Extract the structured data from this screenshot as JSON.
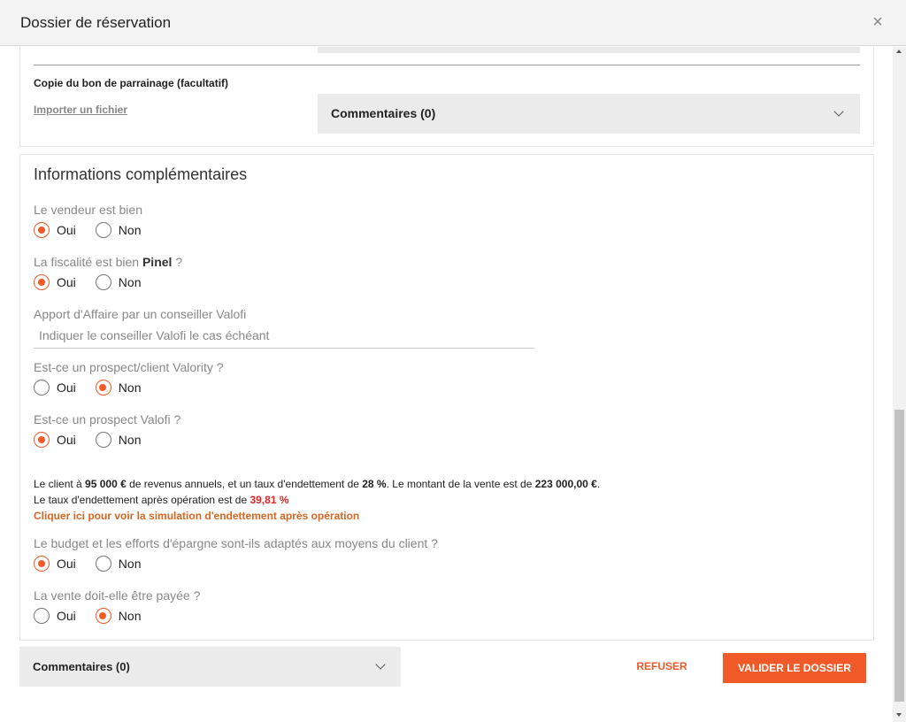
{
  "header": {
    "title": "Dossier de réservation",
    "close_symbol": "×"
  },
  "upload": {
    "label": "Copie du bon de parrainage (facultatif)",
    "import_link": "Importer un fichier",
    "comments_label": "Commentaires (0)"
  },
  "info": {
    "title": "Informations complémentaires",
    "q1": {
      "label": "Le vendeur est bien",
      "oui": "Oui",
      "non": "Non",
      "selected": "Oui"
    },
    "q2": {
      "label_before": "La fiscalité est bien ",
      "label_bold": "Pinel",
      "label_after": " ?",
      "oui": "Oui",
      "non": "Non",
      "selected": "Oui"
    },
    "apport": {
      "label": "Apport d'Affaire par un conseiller Valofi",
      "placeholder": "Indiquer le conseiller Valofi le cas échéant",
      "value": ""
    },
    "q3": {
      "label": "Est-ce un prospect/client Valority ?",
      "oui": "Oui",
      "non": "Non",
      "selected": "Non"
    },
    "q4": {
      "label": "Est-ce un prospect Valofi ?",
      "oui": "Oui",
      "non": "Non",
      "selected": "Oui"
    },
    "summary": {
      "p1": "Le client à ",
      "revenus": "95 000 €",
      "p2": " de revenus annuels, et un taux d'endettement de ",
      "taux": "28 %",
      "p3": ". Le montant de la vente est de ",
      "montant": "223 000,00 €",
      "p4": ".",
      "line2": "Le taux d'endettement après opération est de ",
      "taux_apres": "39,81 %",
      "link": "Cliquer ici pour voir la simulation d'endettement après opération"
    },
    "q5": {
      "label": "Le budget et les efforts d'épargne sont-ils adaptés aux moyens du client ?",
      "oui": "Oui",
      "non": "Non",
      "selected": "Oui"
    },
    "q6": {
      "label": "La vente doit-elle être payée ?",
      "oui": "Oui",
      "non": "Non",
      "selected": "Non"
    }
  },
  "footer": {
    "comments_label": "Commentaires (0)",
    "refuse": "REFUSER",
    "validate": "VALIDER LE DOSSIER"
  },
  "colors": {
    "accent": "#f05a28",
    "danger": "#e02424",
    "link": "#d86520"
  }
}
